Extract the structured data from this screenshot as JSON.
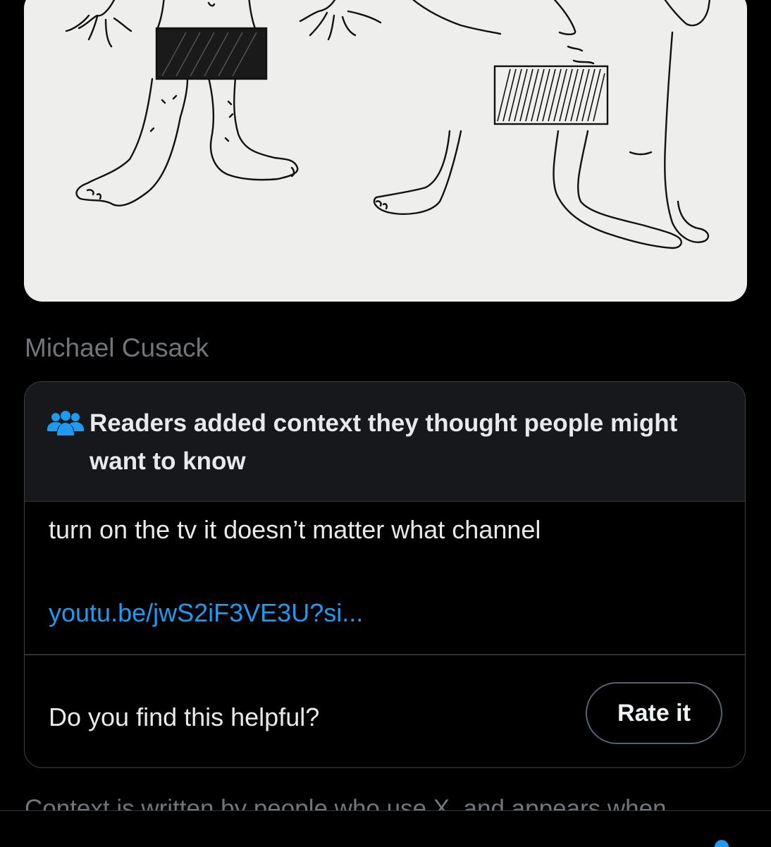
{
  "post": {
    "caption": "Michael Cusack"
  },
  "community_note": {
    "header_icon": "people-group-icon",
    "title": "Readers added context they thought people might want to know",
    "body": "turn on the tv it doesn’t matter what channel",
    "link_text": "youtu.be/jwS2iF3VE3U?si...",
    "helpful_question": "Do you find this helpful?",
    "rate_button_label": "Rate it"
  },
  "footer": {
    "context_text": "Context is written by people who use X, and appears when"
  },
  "colors": {
    "background": "#000000",
    "note_header_bg": "#16181c",
    "border": "#2f3336",
    "muted_text": "#71767b",
    "primary_text": "#e7e9ea",
    "link": "#1d9bf0",
    "paper": "#eeeeec"
  }
}
